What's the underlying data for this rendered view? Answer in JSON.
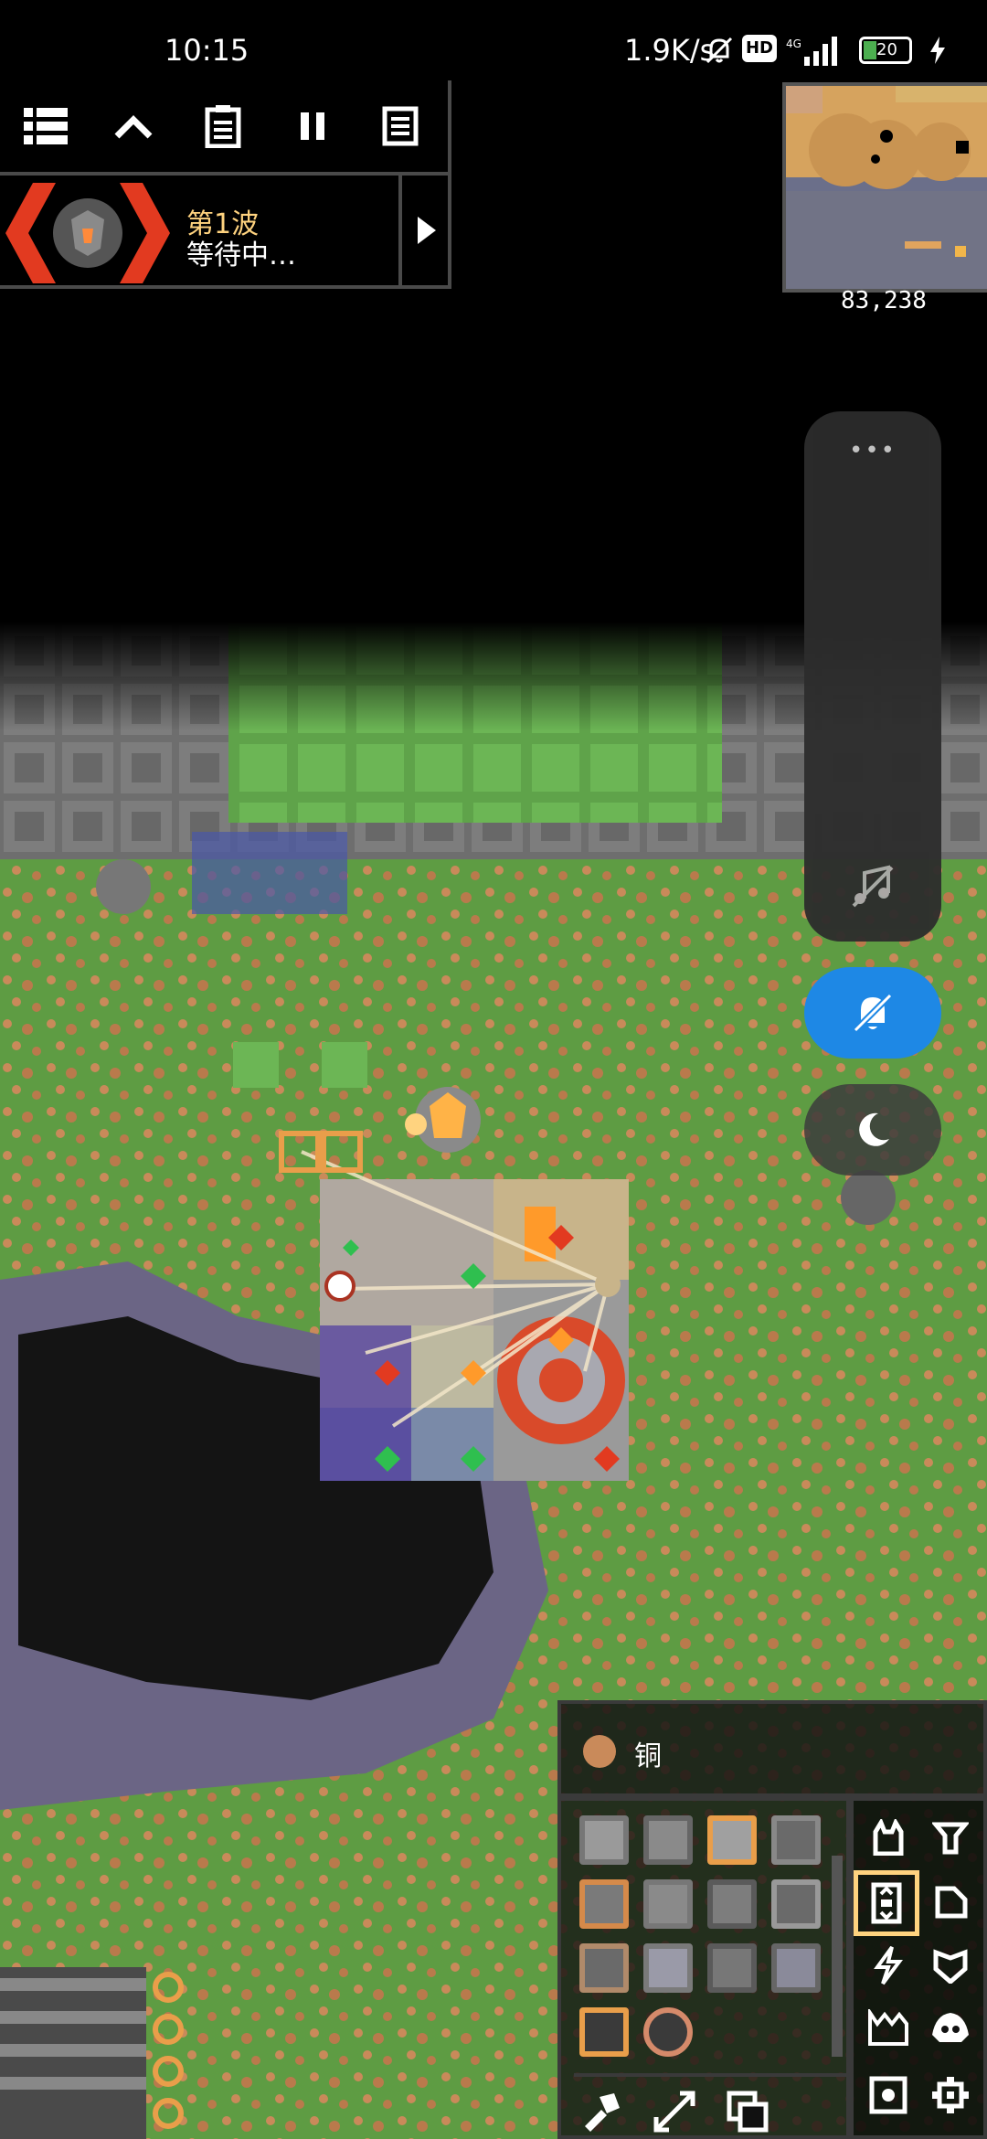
{
  "status_bar": {
    "time": "10:15",
    "net_speed": "1.9K/s",
    "hd_badge": "HD",
    "battery": "20"
  },
  "toolbar": {
    "buttons": [
      "menu-icon",
      "chevron-up-icon",
      "clipboard-icon",
      "pause-icon",
      "document-icon"
    ]
  },
  "wave": {
    "title": "第1波",
    "status": "等待中…",
    "skip_icon": "play-icon"
  },
  "minimap": {
    "coords": "83,238"
  },
  "side_panel": {
    "more_label": "•••",
    "buttons": [
      "music-off-icon",
      "bell-off-icon",
      "moon-icon"
    ],
    "active_color": "#1e88e5"
  },
  "build_menu": {
    "selected_block": "铜",
    "block_rows": 4,
    "categories": [
      "turret-icon",
      "distribution-icon",
      "crafting-icon",
      "defense-icon",
      "power-icon",
      "effect-icon",
      "production-icon",
      "units-icon",
      "logic-icon",
      "gear-icon"
    ],
    "selected_category": "crafting-icon",
    "tools": [
      "hammer-icon",
      "expand-icon",
      "copy-icon"
    ]
  },
  "colors": {
    "grass": "#5e9c43",
    "ore": "#c98a5a",
    "accent": "#ffd37f",
    "wave_red": "#e23a20"
  }
}
